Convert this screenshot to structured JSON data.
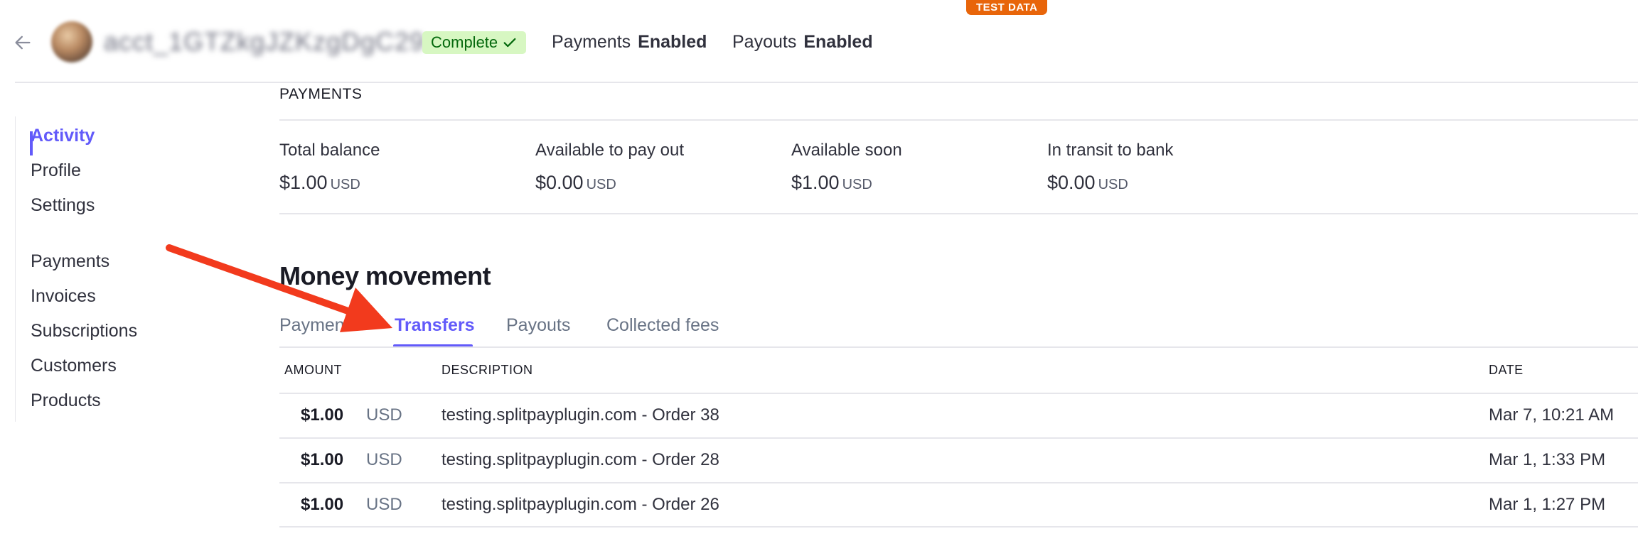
{
  "badge": "TEST DATA",
  "header": {
    "account_id": "acct_1GTZkgJZKzgDgC29",
    "status": "Complete",
    "capabilities": [
      {
        "label": "Payments",
        "value": "Enabled"
      },
      {
        "label": "Payouts",
        "value": "Enabled"
      }
    ]
  },
  "sidebar": {
    "items": [
      "Activity",
      "Profile",
      "Settings",
      "Payments",
      "Invoices",
      "Subscriptions",
      "Customers",
      "Products"
    ],
    "active": "Activity"
  },
  "payments": {
    "section_label": "PAYMENTS",
    "balances": [
      {
        "label": "Total balance",
        "amount": "$1.00",
        "currency": "USD"
      },
      {
        "label": "Available to pay out",
        "amount": "$0.00",
        "currency": "USD"
      },
      {
        "label": "Available soon",
        "amount": "$1.00",
        "currency": "USD"
      },
      {
        "label": "In transit to bank",
        "amount": "$0.00",
        "currency": "USD"
      }
    ]
  },
  "money_movement": {
    "title": "Money movement",
    "tabs": [
      "Payments",
      "Transfers",
      "Payouts",
      "Collected fees"
    ],
    "active_tab": "Transfers",
    "columns": {
      "amount": "AMOUNT",
      "description": "DESCRIPTION",
      "date": "DATE"
    },
    "rows": [
      {
        "amount": "$1.00",
        "currency": "USD",
        "description": "testing.splitpayplugin.com - Order 38",
        "date": "Mar 7, 10:21 AM"
      },
      {
        "amount": "$1.00",
        "currency": "USD",
        "description": "testing.splitpayplugin.com - Order 28",
        "date": "Mar 1, 1:33 PM"
      },
      {
        "amount": "$1.00",
        "currency": "USD",
        "description": "testing.splitpayplugin.com - Order 26",
        "date": "Mar 1, 1:27 PM"
      }
    ]
  },
  "colors": {
    "accent": "#625afa",
    "badge": "#e8650a",
    "success_bg": "#d7f7c2",
    "success_fg": "#05690d",
    "annotation": "#f23a1d"
  },
  "icons": {
    "back": "arrow-left-icon",
    "status": "checkmark-icon",
    "annotation": "red-arrow"
  }
}
